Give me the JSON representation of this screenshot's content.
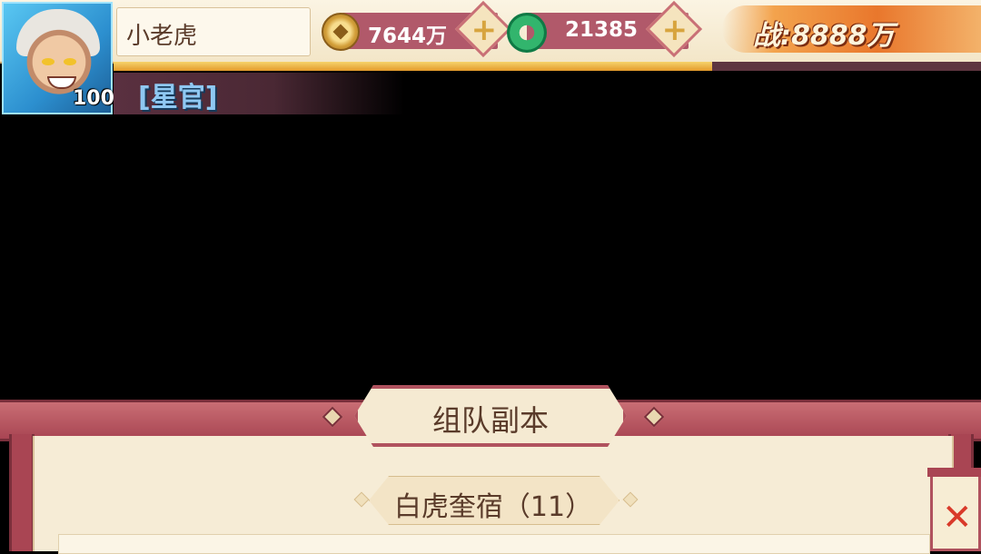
{
  "player": {
    "name": "小老虎",
    "level": "100",
    "title": "[星官]",
    "xp_fraction": 0.69
  },
  "resources": {
    "copper": "7644万",
    "jade": "21385",
    "add_label": "+"
  },
  "power": {
    "label": "战:8888万"
  },
  "panel": {
    "title": "组队副本",
    "dungeon": "白虎奎宿（11）",
    "close_label": "✕"
  },
  "colors": {
    "accent": "#b0525e",
    "parchment": "#f6ecd6",
    "title_blue": "#8fc8f2"
  }
}
